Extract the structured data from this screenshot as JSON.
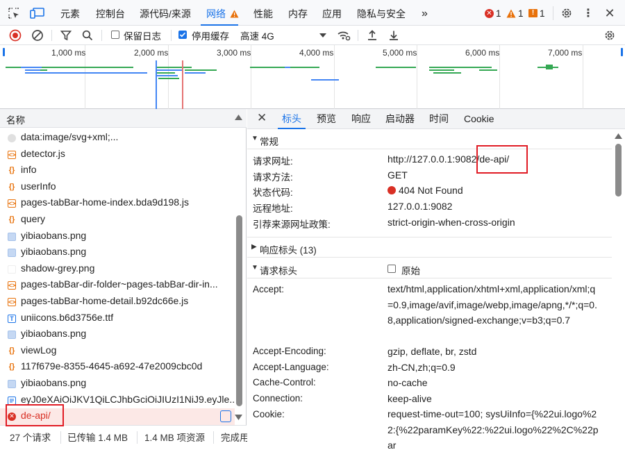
{
  "tabbar": {
    "tabs": [
      "元素",
      "控制台",
      "源代码/来源",
      "网络",
      "性能",
      "内存",
      "应用",
      "隐私与安全"
    ],
    "active_tab": "网络",
    "more": "»",
    "errors": "1",
    "warnings": "1",
    "issues": "1"
  },
  "toolbar": {
    "preserve_log": "保留日志",
    "disable_cache": "停用缓存",
    "throttle": "高速 4G"
  },
  "overview": {
    "ticks": [
      "1,000 ms",
      "2,000 ms",
      "3,000 ms",
      "4,000 ms",
      "5,000 ms",
      "6,000 ms",
      "7,000 ms"
    ],
    "colors": {
      "blue": "#4285f4",
      "green": "#34a853",
      "red": "#e57373"
    }
  },
  "requests": {
    "header": "名称",
    "items": [
      {
        "name": "data:image/svg+xml;...",
        "type": "svg"
      },
      {
        "name": "detector.js",
        "type": "js"
      },
      {
        "name": "info",
        "type": "xhr"
      },
      {
        "name": "userInfo",
        "type": "xhr"
      },
      {
        "name": "pages-tabBar-home-index.bda9d198.js",
        "type": "js"
      },
      {
        "name": "query",
        "type": "xhr"
      },
      {
        "name": "yibiaobans.png",
        "type": "img"
      },
      {
        "name": "yibiaobans.png",
        "type": "img"
      },
      {
        "name": "shadow-grey.png",
        "type": "blank"
      },
      {
        "name": "pages-tabBar-dir-folder~pages-tabBar-dir-in...",
        "type": "js"
      },
      {
        "name": "pages-tabBar-home-detail.b92dc66e.js",
        "type": "js"
      },
      {
        "name": "uniicons.b6d3756e.ttf",
        "type": "font"
      },
      {
        "name": "yibiaobans.png",
        "type": "img"
      },
      {
        "name": "viewLog",
        "type": "xhr"
      },
      {
        "name": "117f679e-8355-4645-a692-47e2009cbc0d",
        "type": "xhr"
      },
      {
        "name": "yibiaobans.png",
        "type": "img"
      },
      {
        "name": "eyJ0eXAiOiJKV1QiLCJhbGciOiJIUzI1NiJ9.eyJle...",
        "type": "doc"
      },
      {
        "name": "de-api/",
        "type": "err"
      }
    ]
  },
  "status": {
    "requests": "27 个请求",
    "transferred": "已传输 1.4 MB",
    "resources": "1.4 MB 项资源",
    "finish": "完成用"
  },
  "detail": {
    "tabs": [
      "标头",
      "预览",
      "响应",
      "启动器",
      "时间",
      "Cookie"
    ],
    "active_tab": "标头",
    "general": {
      "title": "常规",
      "rows": [
        {
          "key": "请求网址:",
          "value": "http://127.0.0.1:9082/de-api/"
        },
        {
          "key": "请求方法:",
          "value": "GET"
        },
        {
          "key": "状态代码:",
          "value": "404 Not Found"
        },
        {
          "key": "远程地址:",
          "value": "127.0.0.1:9082"
        },
        {
          "key": "引荐来源网址政策:",
          "value": "strict-origin-when-cross-origin"
        }
      ]
    },
    "response_headers": "响应标头 (13)",
    "request_headers": "请求标头",
    "raw": "原始",
    "req_rows": [
      {
        "key": "Accept:",
        "value": "text/html,application/xhtml+xml,application/xml;q=0.9,image/avif,image/webp,image/apng,*/*;q=0.8,application/signed-exchange;v=b3;q=0.7"
      },
      {
        "key": "Accept-Encoding:",
        "value": "gzip, deflate, br, zstd"
      },
      {
        "key": "Accept-Language:",
        "value": "zh-CN,zh;q=0.9"
      },
      {
        "key": "Cache-Control:",
        "value": "no-cache"
      },
      {
        "key": "Connection:",
        "value": "keep-alive"
      },
      {
        "key": "Cookie:",
        "value": "request-time-out=100; sysUiInfo={%22ui.logo%22:{%22paramKey%22:%22ui.logo%22%2C%22par"
      }
    ]
  }
}
